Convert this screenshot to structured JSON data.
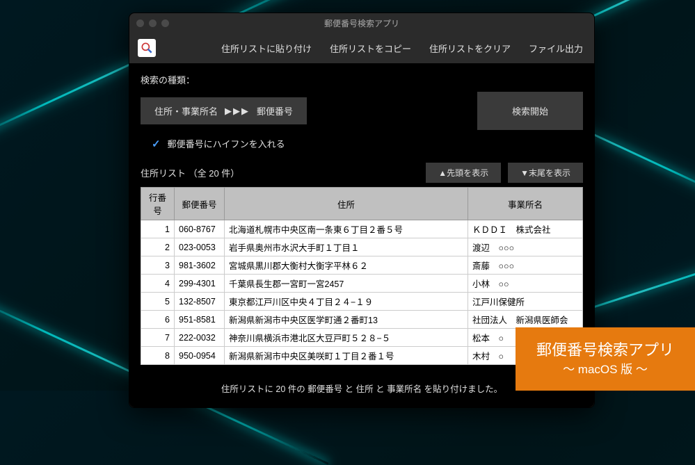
{
  "window": {
    "title": "郵便番号検索アプリ"
  },
  "toolbar": {
    "paste": "住所リストに貼り付け",
    "copy": "住所リストをコピー",
    "clear": "住所リストをクリア",
    "export": "ファイル出力"
  },
  "search": {
    "type_label": "検索の種類：",
    "type_from": "住所・事業所名",
    "type_to": "郵便番号",
    "start": "検索開始",
    "hyphen_option": "郵便番号にハイフンを入れる",
    "hyphen_checked": true
  },
  "list": {
    "label": "住所リスト （全 20 件）",
    "to_top": "▲先頭を表示",
    "to_bottom": "▼末尾を表示",
    "columns": {
      "row": "行番号",
      "postal": "郵便番号",
      "address": "住所",
      "business": "事業所名"
    },
    "rows": [
      {
        "n": "1",
        "pc": "060-8767",
        "addr": "北海道札幌市中央区南一条東６丁目２番５号",
        "biz": "ＫＤＤＩ　株式会社"
      },
      {
        "n": "2",
        "pc": "023-0053",
        "addr": "岩手県奥州市水沢大手町１丁目１",
        "biz": "渡辺　○○○"
      },
      {
        "n": "3",
        "pc": "981-3602",
        "addr": "宮城県黒川郡大衡村大衡字平林６２",
        "biz": "斎藤　○○○"
      },
      {
        "n": "4",
        "pc": "299-4301",
        "addr": "千葉県長生郡一宮町一宮2457",
        "biz": "小林　○○"
      },
      {
        "n": "5",
        "pc": "132-8507",
        "addr": "東京都江戸川区中央４丁目２４−１９",
        "biz": "江戸川保健所"
      },
      {
        "n": "6",
        "pc": "951-8581",
        "addr": "新潟県新潟市中央区医学町通２番町13",
        "biz": "社団法人　新潟県医師会"
      },
      {
        "n": "7",
        "pc": "222-0032",
        "addr": "神奈川県横浜市港北区大豆戸町５２８−５",
        "biz": "松本　○"
      },
      {
        "n": "8",
        "pc": "950-0954",
        "addr": "新潟県新潟市中央区美咲町１丁目２番１号",
        "biz": "木村　○"
      }
    ]
  },
  "status": "住所リストに 20 件の 郵便番号 と 住所 と 事業所名 を貼り付けました。",
  "badge": {
    "title": "郵便番号検索アプリ",
    "sub": "〜 macOS 版 〜"
  }
}
